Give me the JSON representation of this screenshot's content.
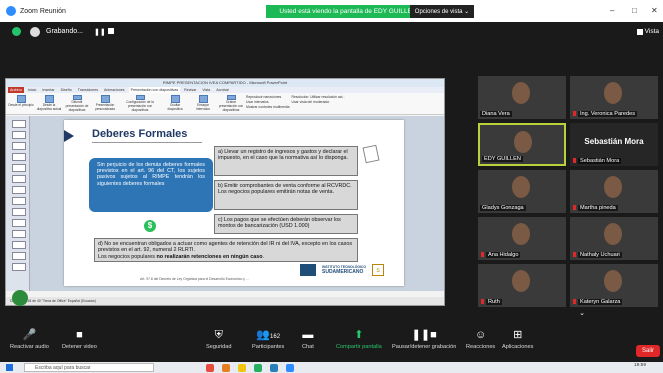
{
  "window": {
    "title": "Zoom Reunión",
    "share_banner": "Usted está viendo la pantalla de EDY GUILLEN",
    "view_options": "Opciones de vista",
    "minimize": "–",
    "maximize": "□",
    "close": "✕"
  },
  "topbar": {
    "recording_label": "Grabando...",
    "view_label": "Vista"
  },
  "ppt": {
    "window_title": "RIMPE PRESENTACION IVEA COMPARTIDO - Microsoft PowerPoint",
    "tabs": [
      "Archivo",
      "Inicio",
      "Insertar",
      "Diseño",
      "Transiciones",
      "Animaciones",
      "Presentación con diapositivas",
      "Revisar",
      "Vista",
      "Acrobat"
    ],
    "ribbon": [
      "Desde el principio",
      "Desde la diapositiva actual",
      "Difundir presentación de diapositivas",
      "Presentación personalizada",
      "Configuración de la presentación con diapositivas",
      "Ocultar diapositiva",
      "Ensayar intervalos",
      "Grabar presentación con diapositivas"
    ],
    "ribbon_options": [
      "Reproducir narraciones",
      "Usar intervalos",
      "Mostrar controles multimedia"
    ],
    "resolution_label": "Resolución: Utilizar resolución act...",
    "presenter_view": "Usar vista del moderador",
    "status": "Diapositiva 18 de 40  \"Tema de Office\"  Español (Ecuador)",
    "slide": {
      "title": "Deberes Formales",
      "blue_box": "Sin perjuicio de los demás deberes formales previstos en el art. 96 del CT, los sujetos pasivos sujetos al RIMPE tendrán los siguientes deberes formales",
      "money_symbol": "$",
      "box_a": "a) Llevar un registro de ingresos y gastos y declarar el impuesto, en el caso que la normativa así lo disponga.",
      "box_b_1": "b) Emitir comprobantes de venta conforme al RCVRDC.",
      "box_b_2": "Los negocios populares emitirán notas de venta.",
      "box_c": "c) Los pagos que se efectúen deberán observar los montos de bancarización (USD 1.000)",
      "box_d": "d) No se encuentran obligados a actuar como agentes de retención del IR ni del IVA, excepto en los casos previstos en el art. 92, numeral 2 RLRTI.",
      "box_d_plain": "Los negocios populares ",
      "box_d_bold": "no realizarán retenciones en ningún caso",
      "box_d_end": ".",
      "footer_note": "Art. 97.8 del Decreto de Ley Orgánica para el Desarrollo Económico y ...",
      "institute": "INSTITUTO TECNOLÓGICO",
      "brand": "SUDAMERICANO"
    }
  },
  "participants": [
    {
      "name": "Diana Vera",
      "muted": false,
      "video": true
    },
    {
      "name": "Ing. Veronica Paredes",
      "muted": true,
      "video": true
    },
    {
      "name": "EDY GUILLEN",
      "muted": false,
      "video": true,
      "active": true
    },
    {
      "name": "Sebastián Mora",
      "muted": true,
      "video": false,
      "display": "Sebastián Mora"
    },
    {
      "name": "Gladys Gonzaga",
      "muted": false,
      "video": true
    },
    {
      "name": "Martha pineda",
      "muted": true,
      "video": true
    },
    {
      "name": "Ana Hidalgo",
      "muted": true,
      "video": true
    },
    {
      "name": "Nathaly Uchuari",
      "muted": true,
      "video": true
    },
    {
      "name": "Ruth",
      "muted": true,
      "video": true
    },
    {
      "name": "Kateryn Galarza",
      "muted": true,
      "video": true
    }
  ],
  "toolbar": {
    "audio": "Reactivar audio",
    "video": "Detener video",
    "security": "Seguridad",
    "participants": "Participantes",
    "participants_count": "162",
    "chat": "Chat",
    "share": "Compartir pantalla",
    "record": "Pausar/detener grabación",
    "reactions": "Reacciones",
    "apps": "Aplicaciones",
    "leave": "Salir"
  },
  "taskbar": {
    "search_placeholder": "Escriba aquí para buscar",
    "time": "19:59"
  },
  "colors": {
    "share_green": "#1db954",
    "leave_red": "#e02828",
    "slide_blue": "#2e75b6",
    "active_tile": "#b8d23c"
  }
}
